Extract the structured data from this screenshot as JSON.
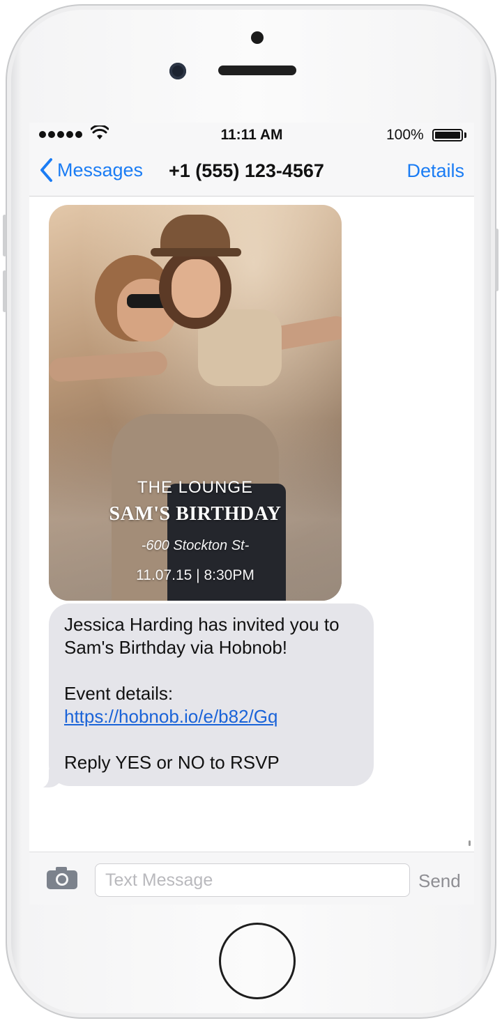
{
  "status_bar": {
    "time": "11:11 AM",
    "battery": "100%"
  },
  "nav": {
    "back_label": "Messages",
    "contact": "+1 (555) 123-4567",
    "details_label": "Details"
  },
  "invitation_image": {
    "venue": "THE LOUNGE",
    "event_title": "SAM'S BIRTHDAY",
    "street": "-600 Stockton St-",
    "date_time": "11.07.15 | 8:30PM"
  },
  "message": {
    "line1": " Jessica Harding  has invited you to Sam's Birthday via Hobnob!",
    "details_prefix": "Event details: ",
    "link": "https://hobnob.io/e/b82/Gq",
    "rsvp": "Reply YES or NO to RSVP"
  },
  "input_bar": {
    "placeholder": "Text Message",
    "send_label": "Send"
  },
  "colors": {
    "accent": "#1a7cf4",
    "bubble": "#e5e5ea"
  }
}
